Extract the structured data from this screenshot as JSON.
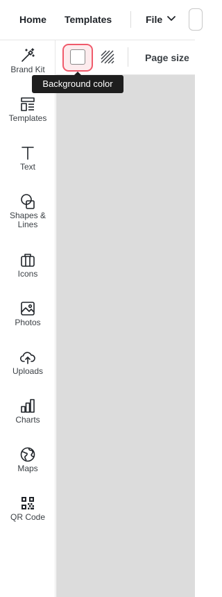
{
  "topbar": {
    "home_label": "Home",
    "templates_label": "Templates",
    "file_label": "File"
  },
  "toolbar": {
    "page_size_label": "Page size",
    "tooltip": "Background color",
    "background_swatch_color": "#ffffff",
    "highlight_color": "#f05a6b"
  },
  "sidebar": {
    "items": [
      {
        "label": "Brand Kit",
        "icon": "magic-wand-icon"
      },
      {
        "label": "Templates",
        "icon": "templates-icon"
      },
      {
        "label": "Text",
        "icon": "text-icon"
      },
      {
        "label": "Shapes & Lines",
        "icon": "shapes-icon"
      },
      {
        "label": "Icons",
        "icon": "briefcase-icon"
      },
      {
        "label": "Photos",
        "icon": "image-icon"
      },
      {
        "label": "Uploads",
        "icon": "cloud-upload-icon"
      },
      {
        "label": "Charts",
        "icon": "bar-chart-icon"
      },
      {
        "label": "Maps",
        "icon": "globe-icon"
      },
      {
        "label": "QR Code",
        "icon": "qr-code-icon"
      }
    ]
  },
  "canvas": {
    "background": "#dcdcdc"
  }
}
